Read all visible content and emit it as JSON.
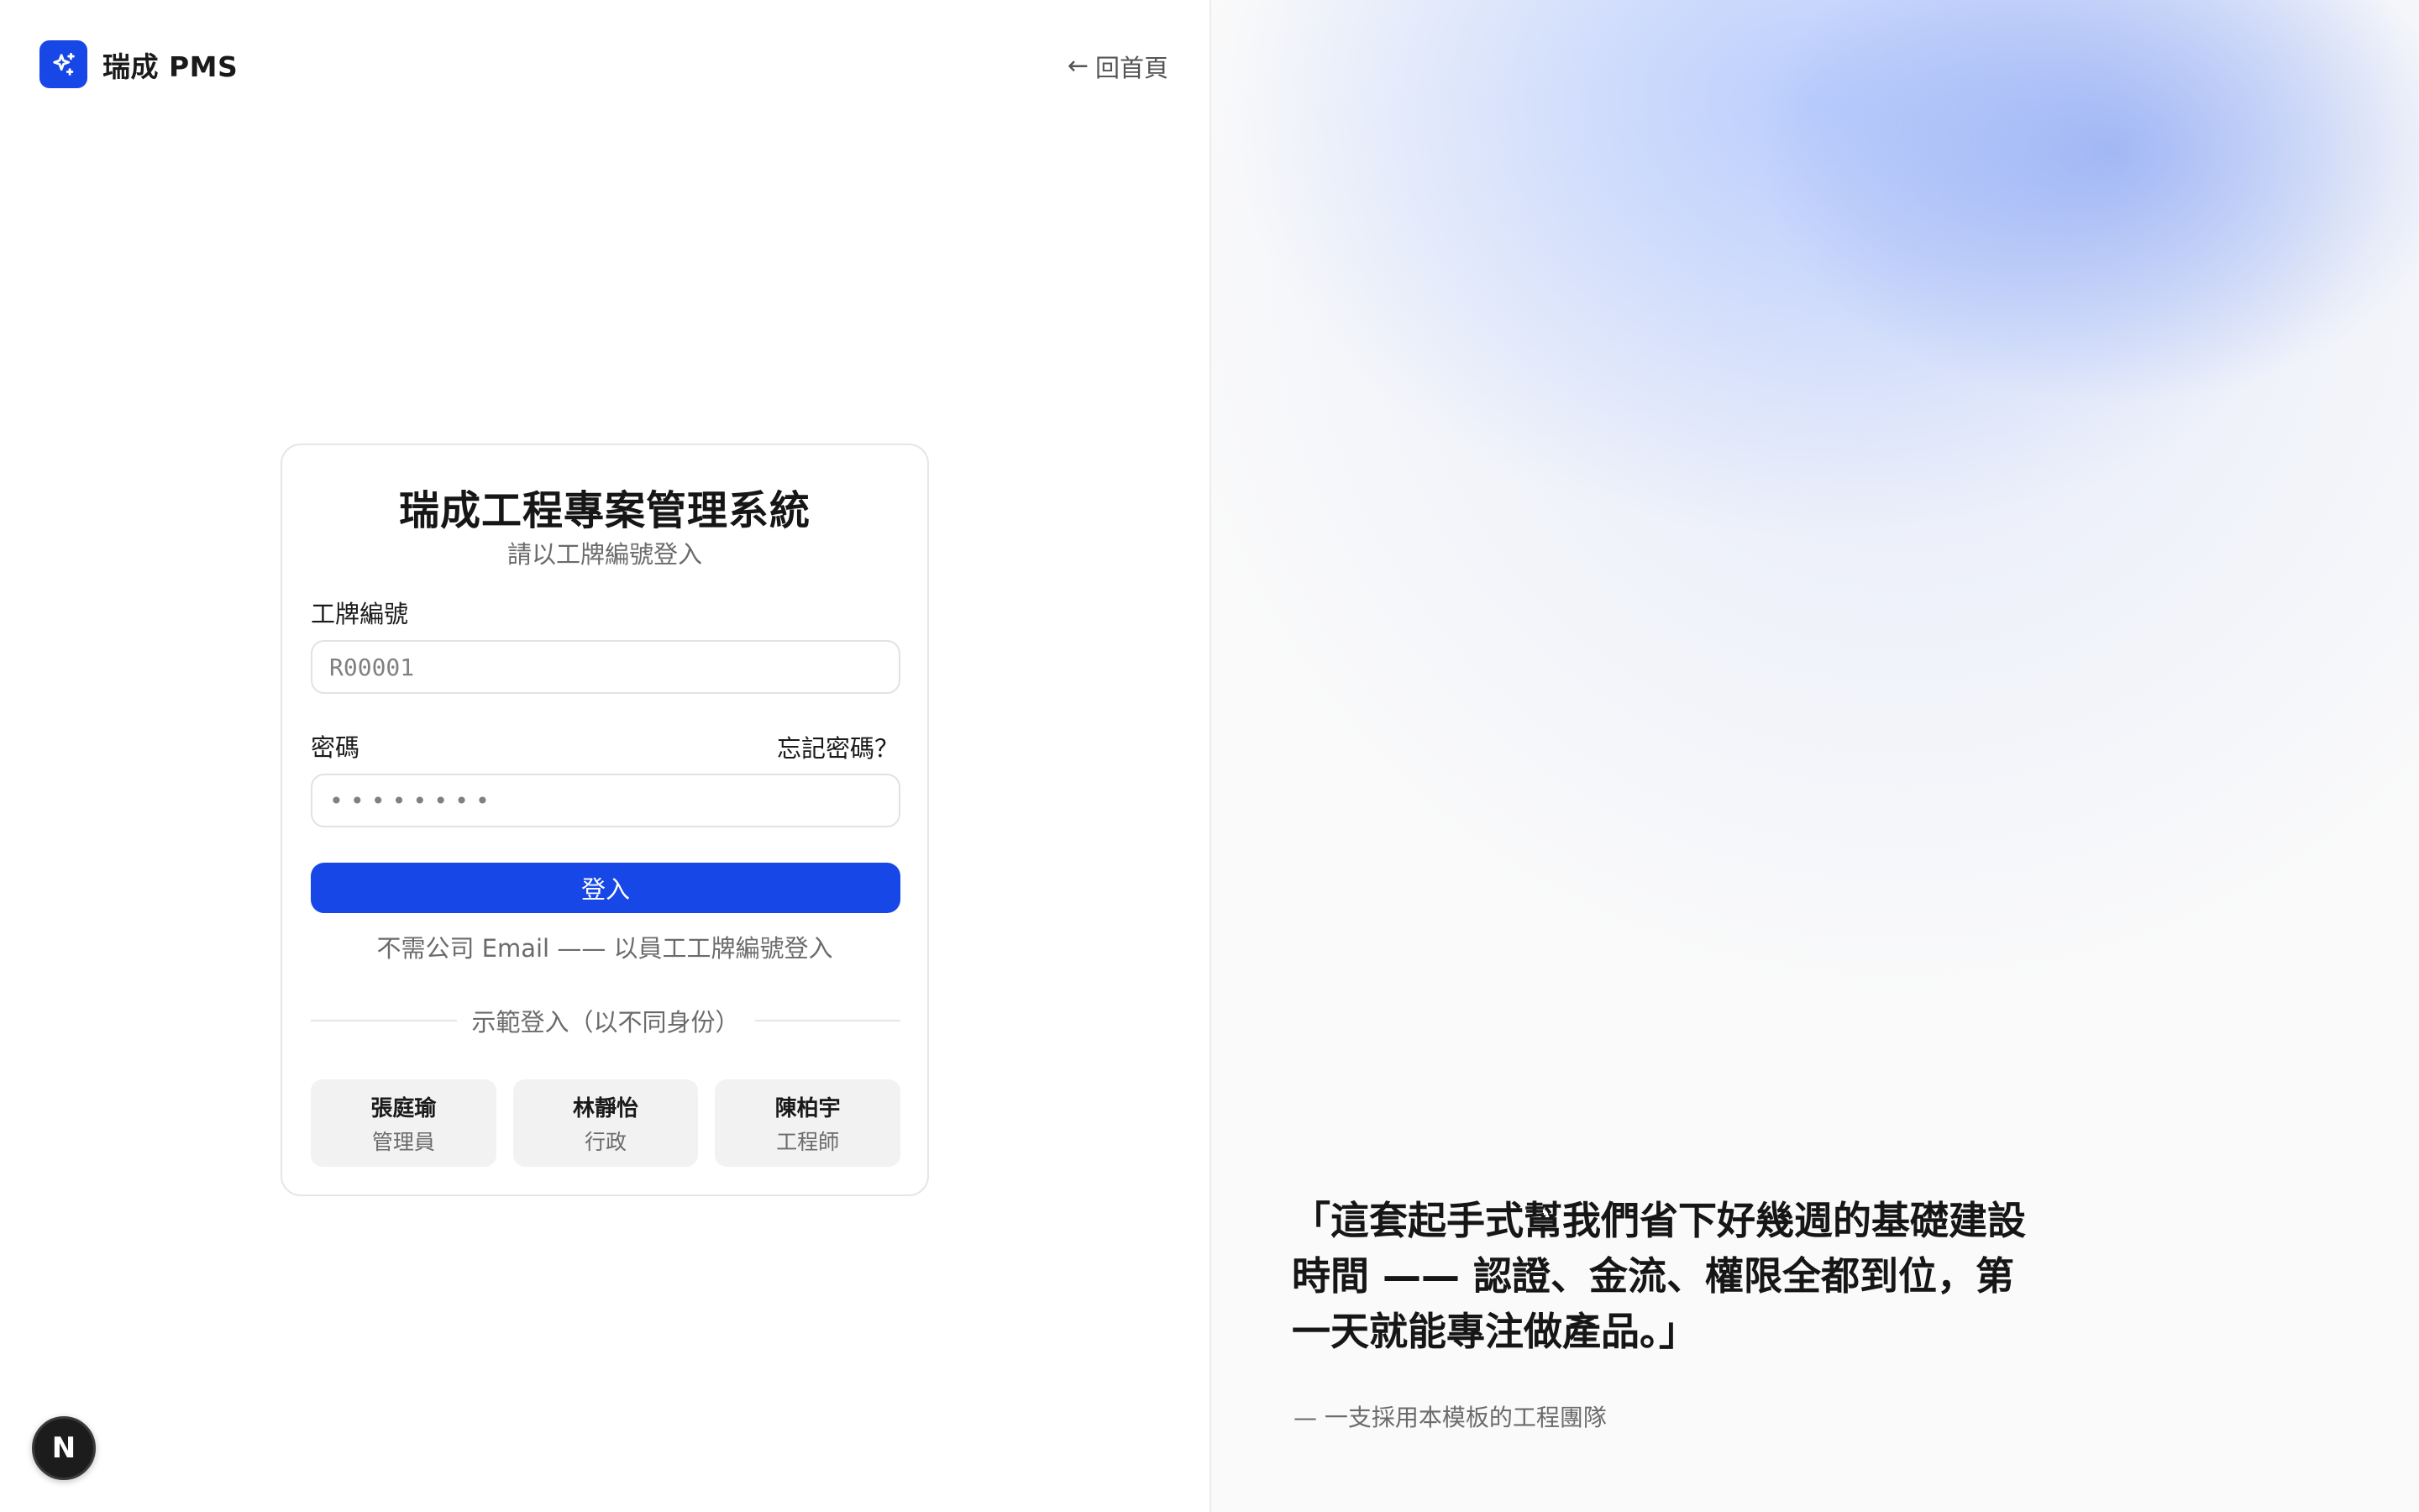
{
  "brand": {
    "logo_icon": "sparkles-icon",
    "name": "瑞成 PMS",
    "accent_color": "#1747e6"
  },
  "nav": {
    "back_arrow": "←",
    "back_label": "回首頁"
  },
  "login_card": {
    "title": "瑞成工程專案管理系統",
    "subtitle": "請以工牌編號登入",
    "badge_label": "工牌編號",
    "badge_placeholder": "R00001",
    "password_label": "密碼",
    "forgot_label": "忘記密碼？",
    "password_placeholder": "••••••••",
    "submit_label": "登入",
    "hint": "不需公司 Email —— 以員工工牌編號登入",
    "demo_divider": "示範登入（以不同身份）",
    "demo_accounts": [
      {
        "name": "張庭瑜",
        "role": "管理員"
      },
      {
        "name": "林靜怡",
        "role": "行政"
      },
      {
        "name": "陳柏宇",
        "role": "工程師"
      }
    ]
  },
  "dev_badge": {
    "letter": "N"
  },
  "testimonial": {
    "quote": "「這套起手式幫我們省下好幾週的基礎建設時間 —— 認證、金流、權限全都到位，第一天就能專注做產品。」",
    "author": "— 一支採用本模板的工程團隊"
  }
}
